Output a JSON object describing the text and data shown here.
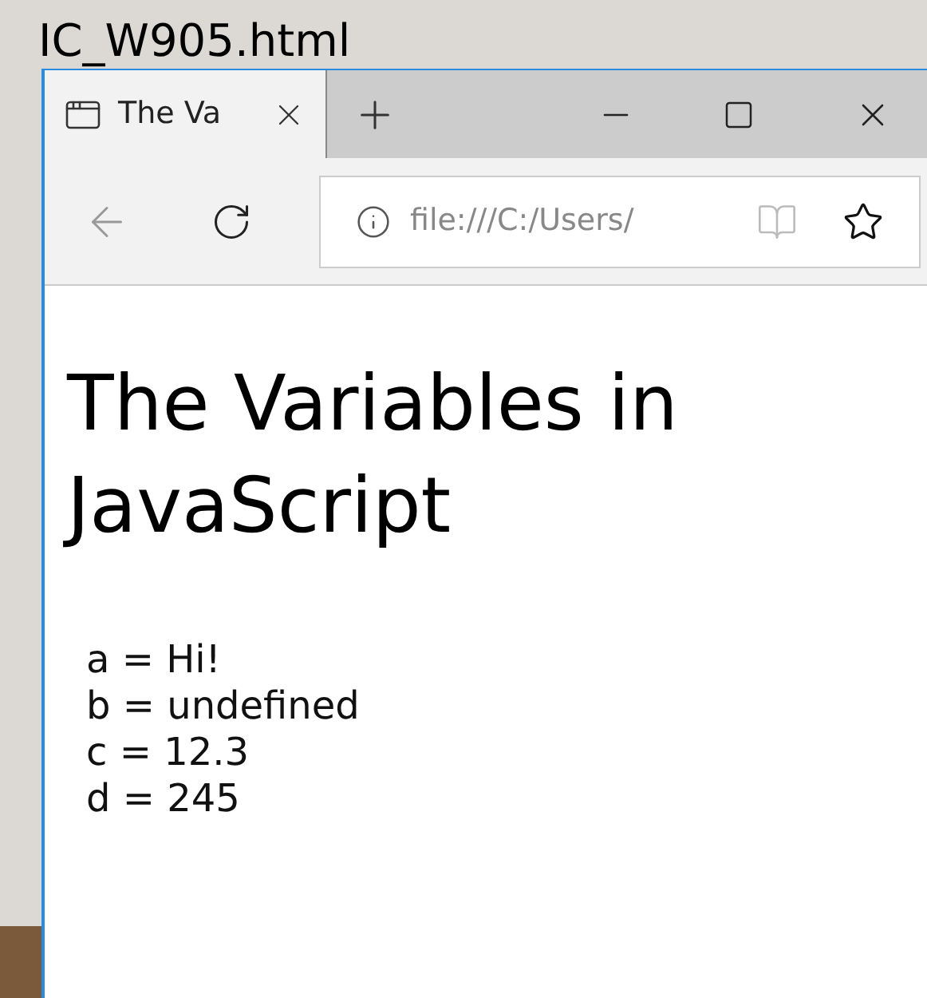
{
  "file_label": "IC_W905.html",
  "tab": {
    "title": "The Va",
    "selected": true
  },
  "address": {
    "value": "file:///C:/Users/"
  },
  "content": {
    "heading": "The Variables in JavaScript",
    "lines": [
      "a = Hi!",
      "b = undefined",
      "c = 12.3",
      "d = 245"
    ]
  }
}
